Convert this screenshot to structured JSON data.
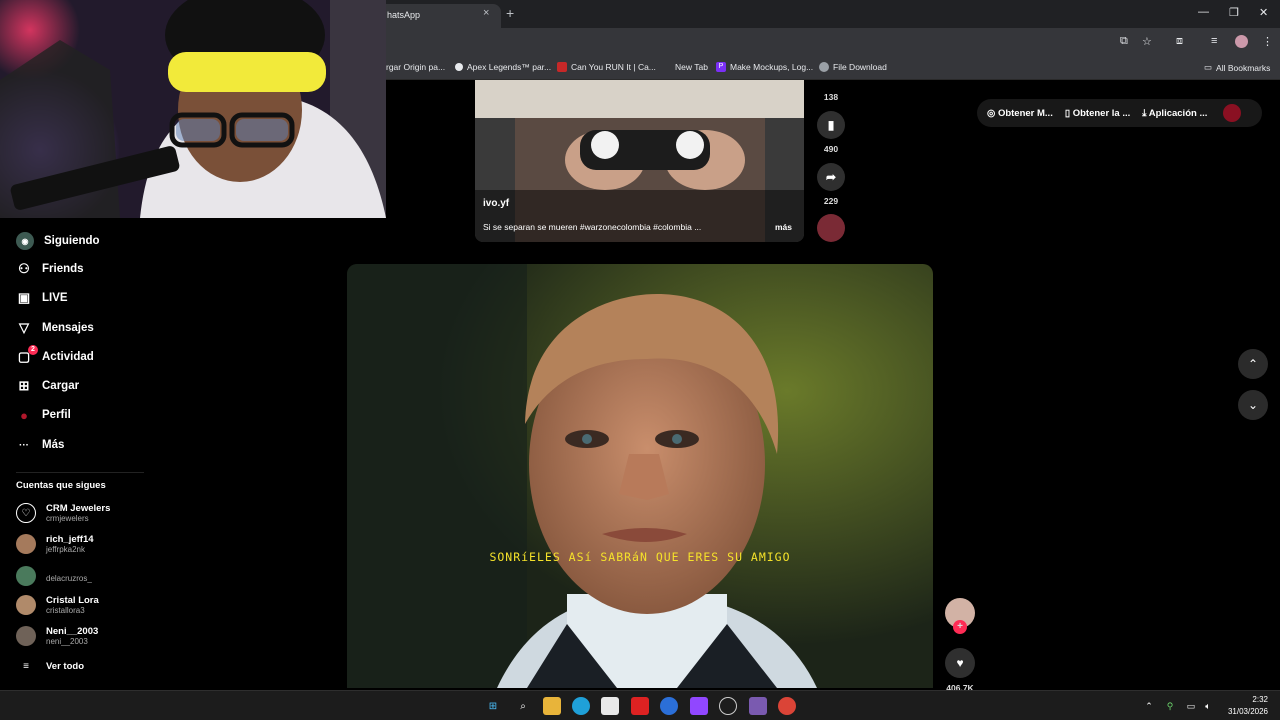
{
  "browser": {
    "active_tab": "hatsApp",
    "tab_close": "×",
    "new_tab": "+",
    "win_controls": [
      "—",
      "❐",
      "✕"
    ],
    "bookmarks": [
      {
        "label": "rgar Origin pa...",
        "color": "#e8eaed"
      },
      {
        "label": "Apex Legends™ par...",
        "color": "#e8eaed"
      },
      {
        "label": "Can You RUN It | Ca...",
        "color": "#c62828"
      },
      {
        "label": "New Tab",
        "color": ""
      },
      {
        "label": "Make Mockups, Log...",
        "color": "#7b2ff7"
      },
      {
        "label": "File Download",
        "color": "#9aa0a6"
      }
    ],
    "all_bookmarks": "All Bookmarks"
  },
  "sidebar": {
    "items": [
      {
        "label": "Siguiendo",
        "icon": "following-icon",
        "glyph": "◉"
      },
      {
        "label": "Friends",
        "icon": "friends-icon",
        "glyph": "⚇"
      },
      {
        "label": "LIVE",
        "icon": "live-icon",
        "glyph": "▣"
      },
      {
        "label": "Mensajes",
        "icon": "messages-icon",
        "glyph": "▽"
      },
      {
        "label": "Actividad",
        "icon": "activity-icon",
        "glyph": "▢",
        "badge": "2"
      },
      {
        "label": "Cargar",
        "icon": "upload-icon",
        "glyph": "⊞"
      },
      {
        "label": "Perfil",
        "icon": "profile-icon",
        "glyph": "●"
      },
      {
        "label": "Más",
        "icon": "more-icon",
        "glyph": "···"
      }
    ],
    "following_title": "Cuentas que sigues",
    "accounts": [
      {
        "name": "CRM Jewelers",
        "handle": "crmjewelers"
      },
      {
        "name": "rich_jeff14",
        "handle": "jeffrpka2nk"
      },
      {
        "name": "",
        "handle": "delacruzros_"
      },
      {
        "name": "Cristal Lora",
        "handle": "cristallora3"
      },
      {
        "name": "Neni__2003",
        "handle": "neni__2003"
      }
    ],
    "see_all": "Ver todo"
  },
  "feed": {
    "top_video": {
      "author": "ivo.yf",
      "caption": "Si se separan se mueren #warzonecolombia #colombia ...",
      "more": "más",
      "counts": [
        "138",
        "490",
        "229"
      ]
    },
    "main_video": {
      "subtitle": "SONRíELES ASí SABRáN QUE ERES SU AMIGO",
      "like_count": "406.7K"
    }
  },
  "header_pill": {
    "items": [
      "Obtener M...",
      "Obtener la ...",
      "Aplicación ..."
    ]
  },
  "taskbar": {
    "time": "2:32",
    "date": "31/03/2026"
  }
}
